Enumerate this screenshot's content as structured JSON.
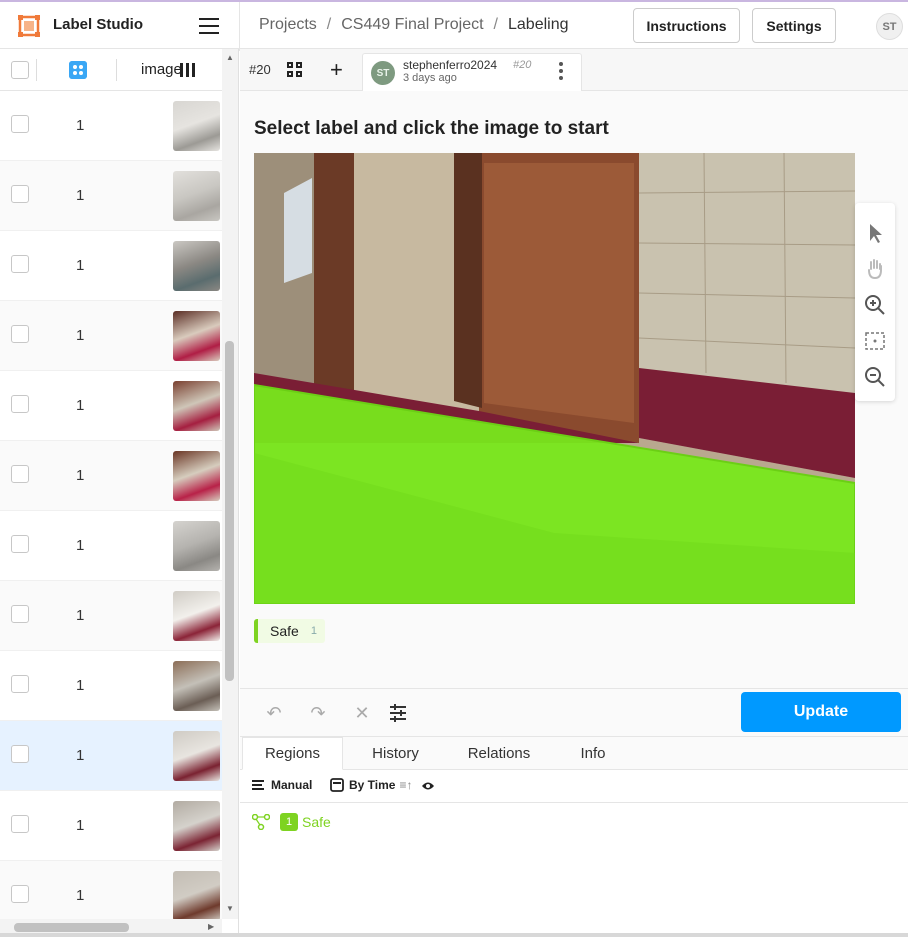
{
  "app": {
    "title": "Label Studio"
  },
  "breadcrumb": {
    "items": [
      "Projects",
      "CS449 Final Project",
      "Labeling"
    ]
  },
  "header": {
    "instructions_label": "Instructions",
    "settings_label": "Settings",
    "user_initials": "ST"
  },
  "table": {
    "image_column_label": "image",
    "rows": [
      {
        "value": "1",
        "selected": false
      },
      {
        "value": "1",
        "selected": false
      },
      {
        "value": "1",
        "selected": false
      },
      {
        "value": "1",
        "selected": false
      },
      {
        "value": "1",
        "selected": false
      },
      {
        "value": "1",
        "selected": false
      },
      {
        "value": "1",
        "selected": false
      },
      {
        "value": "1",
        "selected": false
      },
      {
        "value": "1",
        "selected": false
      },
      {
        "value": "1",
        "selected": true
      },
      {
        "value": "1",
        "selected": false
      },
      {
        "value": "1",
        "selected": false
      }
    ]
  },
  "task": {
    "id_label": "#20"
  },
  "annotation": {
    "avatar_initials": "ST",
    "user": "stephenferro2024",
    "number": "#20",
    "time": "3 days ago"
  },
  "labeling": {
    "instruction": "Select label and click the image to start",
    "label_name": "Safe",
    "label_hotkey": "1"
  },
  "colors": {
    "label_safe": "#7ed321",
    "update_button": "#0099ff"
  },
  "actions": {
    "update_label": "Update"
  },
  "panel": {
    "tabs": [
      "Regions",
      "History",
      "Relations",
      "Info"
    ],
    "active_tab": "Regions",
    "toolbar": {
      "manual_label": "Manual",
      "sort_label": "By Time"
    },
    "regions": [
      {
        "index": "1",
        "label": "Safe"
      }
    ]
  }
}
